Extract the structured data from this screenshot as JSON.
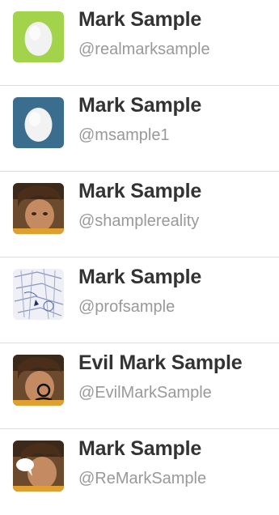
{
  "accounts": [
    {
      "name": "Mark Sample",
      "handle": "@realmarksample",
      "avatar": "default-egg-icon",
      "avatar_color": "#a3d34b"
    },
    {
      "name": "Mark Sample",
      "handle": "@msample1",
      "avatar": "default-egg-icon",
      "avatar_color": "#3a6d8e"
    },
    {
      "name": "Mark Sample",
      "handle": "@shamplereality",
      "avatar": "profile-photo"
    },
    {
      "name": "Mark Sample",
      "handle": "@profsample",
      "avatar": "map-sketch-image"
    },
    {
      "name": "Evil Mark Sample",
      "handle": "@EvilMarkSample",
      "avatar": "profile-photo-monocle"
    },
    {
      "name": "Mark Sample",
      "handle": "@ReMarkSample",
      "avatar": "profile-photo-speech-bubble"
    }
  ]
}
